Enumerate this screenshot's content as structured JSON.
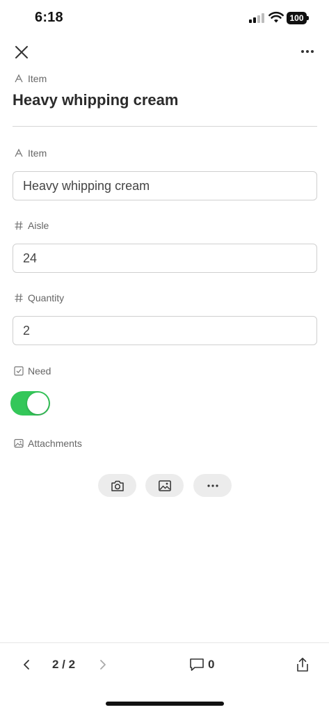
{
  "status_bar": {
    "time": "6:18",
    "battery": "100"
  },
  "header": {
    "close_icon": "close-icon",
    "more_icon": "more-horizontal-icon"
  },
  "record": {
    "label": "Item",
    "title": "Heavy whipping cream"
  },
  "fields": {
    "item": {
      "label": "Item",
      "value": "Heavy whipping cream",
      "icon": "text-field-icon"
    },
    "aisle": {
      "label": "Aisle",
      "value": "24",
      "icon": "number-field-icon"
    },
    "quantity": {
      "label": "Quantity",
      "value": "2",
      "icon": "number-field-icon"
    },
    "need": {
      "label": "Need",
      "value": true,
      "icon": "checkbox-field-icon"
    },
    "attachments": {
      "label": "Attachments",
      "icon": "image-field-icon"
    }
  },
  "attachment_buttons": [
    "camera-icon",
    "photo-library-icon",
    "more-horizontal-icon"
  ],
  "footer": {
    "pager": "2 / 2",
    "comment_count": "0"
  },
  "colors": {
    "toggle_on": "#34c759",
    "attach_button_bg": "#ececec"
  }
}
